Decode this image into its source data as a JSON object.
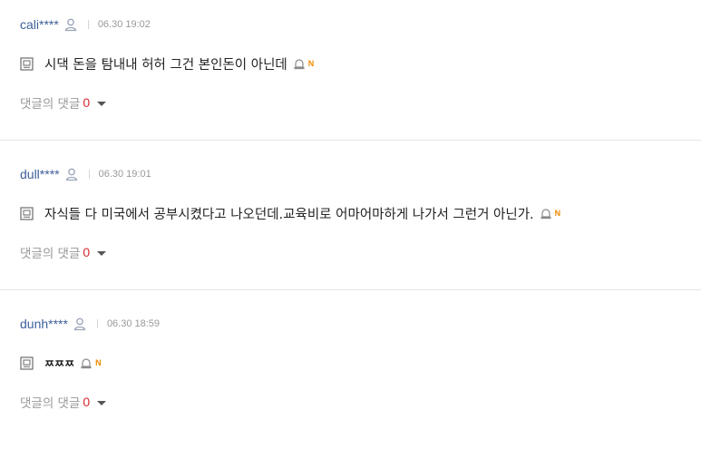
{
  "comments": [
    {
      "username": "cali****",
      "date": "06.30 19:02",
      "text": "시댁 돈을 탐내내 허허 그건 본인돈이 아닌데",
      "new_badge": "N",
      "reply_label": "댓글의 댓글",
      "reply_count": "0"
    },
    {
      "username": "dull****",
      "date": "06.30 19:01",
      "text": "자식들 다 미국에서 공부시켰다고 나오던데.교육비로 어마어마하게 나가서 그런거 아닌가.",
      "new_badge": "N",
      "reply_label": "댓글의 댓글",
      "reply_count": "0"
    },
    {
      "username": "dunh****",
      "date": "06.30 18:59",
      "text": "ㅉㅉㅉ",
      "new_badge": "N",
      "reply_label": "댓글의 댓글",
      "reply_count": "0"
    }
  ],
  "colors": {
    "username": "#3d5f9b",
    "reply_count": "#d7282f",
    "new_badge": "#f08a00",
    "separator": "#e3e3e3"
  },
  "icons": {
    "user": "user-icon",
    "memo": "memo-icon",
    "report": "report-icon",
    "caret": "caret-down-icon"
  }
}
